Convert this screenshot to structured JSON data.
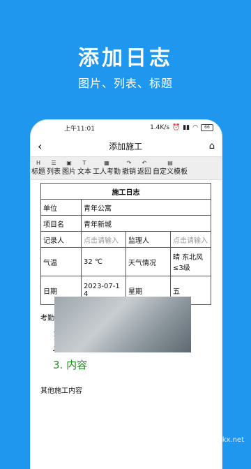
{
  "promo": {
    "title": "添加日志",
    "subtitle": "图片、列表、标题"
  },
  "status": {
    "time": "上午11:01",
    "network": "1.4K/s",
    "battery": "66"
  },
  "nav": {
    "title": "添加施工"
  },
  "toolbar": [
    {
      "icon": "H",
      "label": "标题"
    },
    {
      "icon": "☰",
      "label": "列表"
    },
    {
      "icon": "▣",
      "label": "图片"
    },
    {
      "icon": "T",
      "label": "文本"
    },
    {
      "icon": "▦",
      "label": "工人考勤"
    },
    {
      "icon": "↷",
      "label": "撤销"
    },
    {
      "icon": "↶",
      "label": "返回"
    },
    {
      "icon": "▤",
      "label": "自定义模板"
    }
  ],
  "table": {
    "title": "施工日志",
    "unit_label": "单位",
    "unit_value": "青年公寓",
    "project_label": "项目名",
    "project_value": "青年新城",
    "recorder_label": "记录人",
    "recorder_placeholder": "点击请输入",
    "supervisor_label": "监理人",
    "supervisor_placeholder": "点击请输入",
    "temp_label": "气温",
    "temp_value": "32 ℃",
    "weather_label": "天气情况",
    "weather_value": "晴 东北风≤3级",
    "date_label": "日期",
    "date_value": "2023-07-14",
    "week_label": "星期",
    "week_value": "五"
  },
  "attendance": {
    "label": "考勤",
    "items": [
      {
        "num": "1.",
        "text": "内容"
      },
      {
        "num": "2.",
        "text": "内容"
      },
      {
        "num": "3.",
        "text": "内容"
      }
    ]
  },
  "other": {
    "label": "其他施工内容"
  },
  "watermark": "www.kkx.net"
}
